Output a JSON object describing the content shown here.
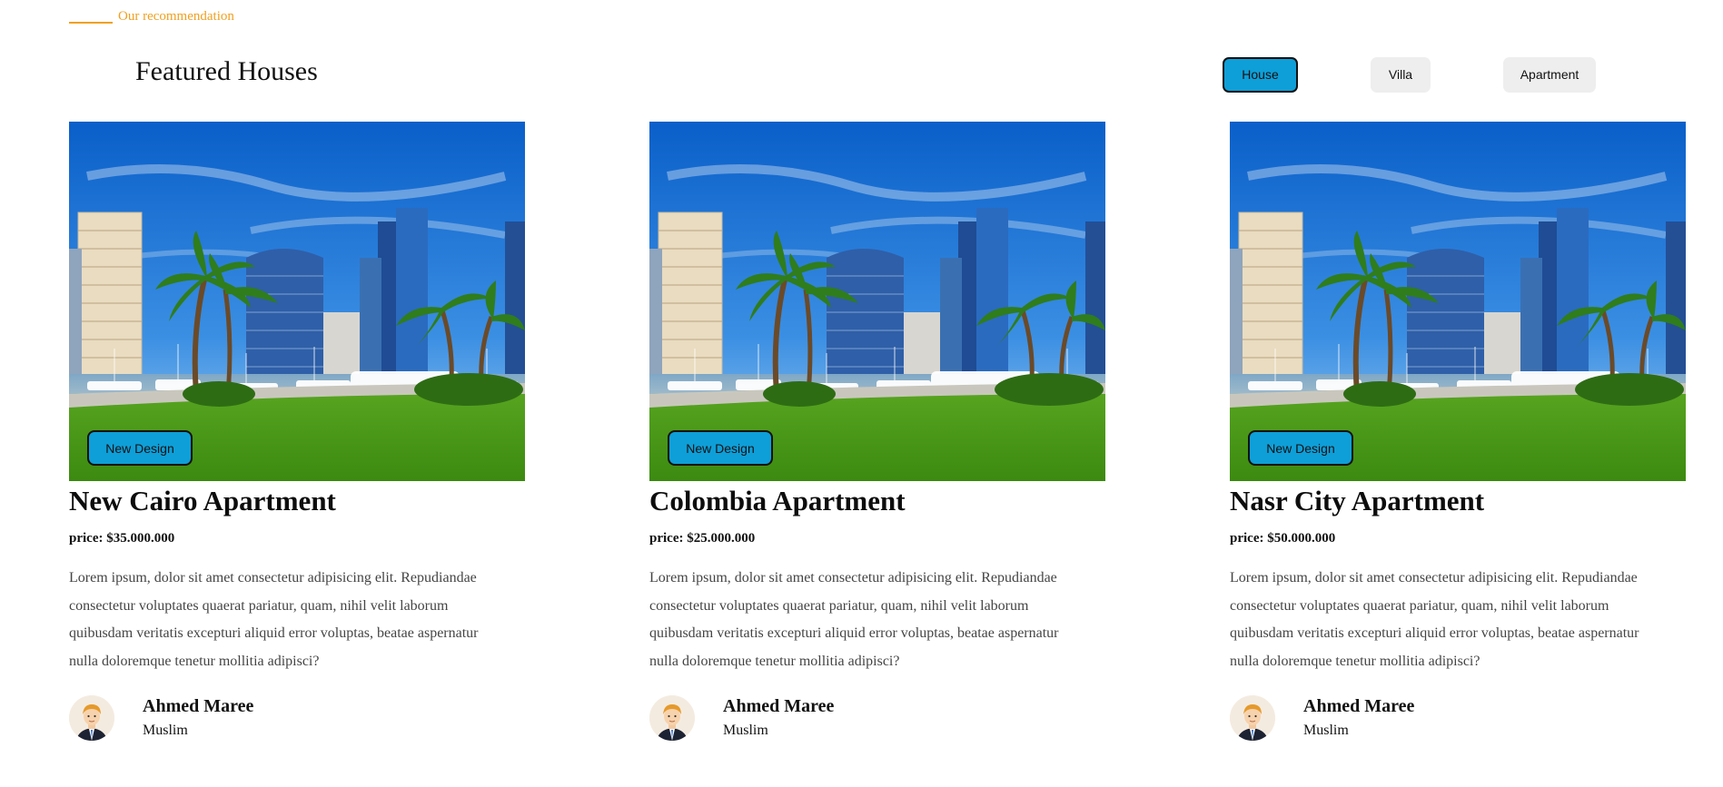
{
  "section": {
    "eyebrow": "Our recommendation",
    "title": "Featured Houses",
    "accent_color": "#f0a020"
  },
  "filters": [
    {
      "label": "House",
      "active": true
    },
    {
      "label": "Villa",
      "active": false
    },
    {
      "label": "Apartment",
      "active": false
    }
  ],
  "cards": [
    {
      "badge": "New Design",
      "title": "New Cairo Apartment",
      "price": "price: $35.000.000",
      "description": "Lorem ipsum, dolor sit amet consectetur adipisicing elit. Repudiandae consectetur voluptates quaerat pariatur, quam, nihil velit laborum quibusdam veritatis excepturi aliquid error voluptas, beatae aspernatur nulla doloremque tenetur mollitia adipisci?",
      "author": {
        "name": "Ahmed Maree",
        "role": "Muslim"
      }
    },
    {
      "badge": "New Design",
      "title": "Colombia Apartment",
      "price": "price: $25.000.000",
      "description": "Lorem ipsum, dolor sit amet consectetur adipisicing elit. Repudiandae consectetur voluptates quaerat pariatur, quam, nihil velit laborum quibusdam veritatis excepturi aliquid error voluptas, beatae aspernatur nulla doloremque tenetur mollitia adipisci?",
      "author": {
        "name": "Ahmed Maree",
        "role": "Muslim"
      }
    },
    {
      "badge": "New Design",
      "title": "Nasr City Apartment",
      "price": "price: $50.000.000",
      "description": "Lorem ipsum, dolor sit amet consectetur adipisicing elit. Repudiandae consectetur voluptates quaerat pariatur, quam, nihil velit laborum quibusdam veritatis excepturi aliquid error voluptas, beatae aspernatur nulla doloremque tenetur mollitia adipisci?",
      "author": {
        "name": "Ahmed Maree",
        "role": "Muslim"
      }
    }
  ],
  "colors": {
    "accent": "#0e9fd8",
    "inactive_filter": "#eeeeee"
  }
}
